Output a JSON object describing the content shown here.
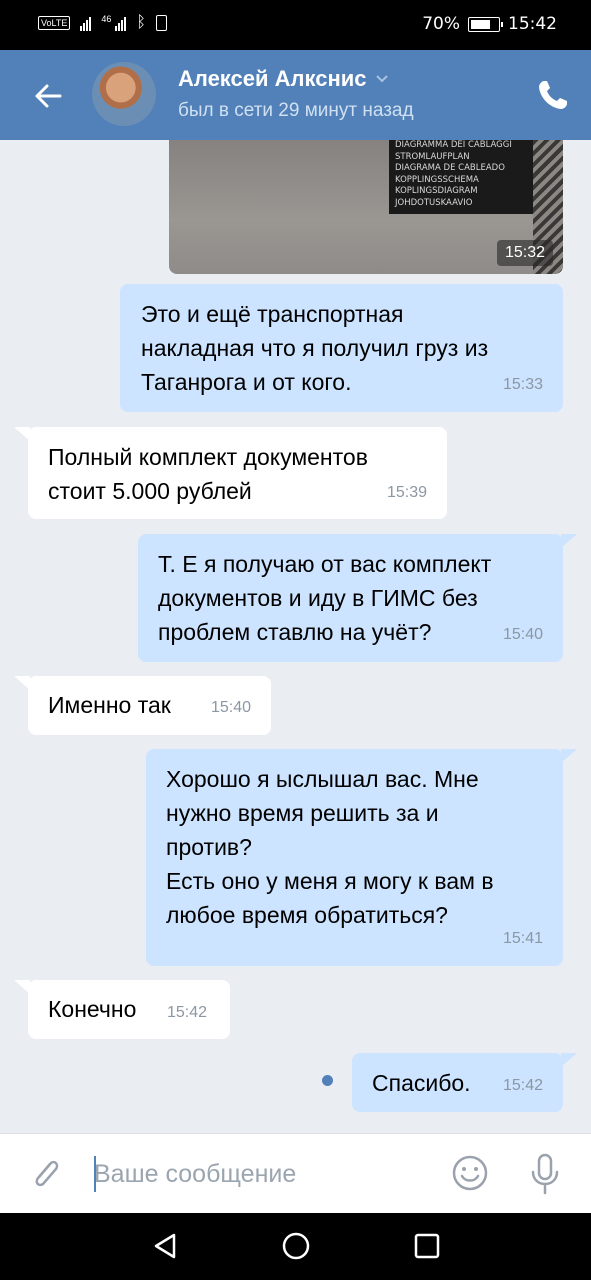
{
  "status_bar": {
    "battery": "70%",
    "time": "15:42",
    "network": "46",
    "volte": "VoLTE"
  },
  "header": {
    "contact_name": "Алексей Алкснис",
    "last_seen": "был в сети 29 минут назад"
  },
  "photo": {
    "sign_lines": [
      "DIAGRAMMA DEI CABLAGGI",
      "STROMLAUFPLAN",
      "DIAGRAMA DE CABLEADO",
      "KOPPLINGSSCHEMA",
      "KOPLINGSDIAGRAM",
      "JOHDOTUSKAAVIO"
    ],
    "time": "15:32"
  },
  "messages": [
    {
      "direction": "out",
      "text": "Это и ещё транспортная\nнакладная что я получил груз из\nТаганрога и от кого.",
      "time": "15:33"
    },
    {
      "direction": "in",
      "text": "Полный комплект документов\nстоит 5.000 рублей",
      "time": "15:39"
    },
    {
      "direction": "out",
      "text": "Т. Е я получаю от вас комплект\nдокументов и иду в ГИМС без\nпроблем ставлю на учёт?",
      "time": "15:40"
    },
    {
      "direction": "in",
      "text": "Именно так",
      "time": "15:40"
    },
    {
      "direction": "out",
      "text": "Хорошо я ыслышал вас. Мне\nнужно время решить за и\nпротив?\nЕсть оно у меня я могу к вам в\nлюбое время обратиться?",
      "time": "15:41"
    },
    {
      "direction": "in",
      "text": "Конечно",
      "time": "15:42"
    },
    {
      "direction": "out",
      "text": "Спасибо.",
      "time": "15:42"
    }
  ],
  "input": {
    "placeholder": "Ваше сообщение"
  },
  "icons": {
    "back": "arrow-left-icon",
    "call": "phone-icon",
    "attach": "paperclip-icon",
    "emoji": "smiley-icon",
    "mic": "microphone-icon"
  },
  "colors": {
    "header": "#5181b8",
    "outgoing_bubble": "#cce4ff",
    "incoming_bubble": "#ffffff",
    "background": "#eaeef3"
  }
}
